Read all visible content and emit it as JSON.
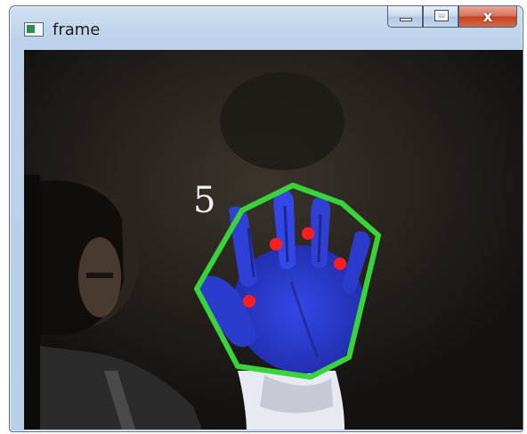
{
  "window": {
    "title": "frame",
    "controls": {
      "minimize_icon": "minimize-icon",
      "maximize_icon": "maximize-icon",
      "close_icon": "close-icon",
      "close_glyph": "x"
    }
  },
  "frame": {
    "finger_count": "5",
    "colors": {
      "hull": "#39d43a",
      "defects": "#ff1e1e",
      "hand_mask": "#2f3fd8",
      "background": "#1a1816",
      "label": "#f2f2f2"
    }
  }
}
